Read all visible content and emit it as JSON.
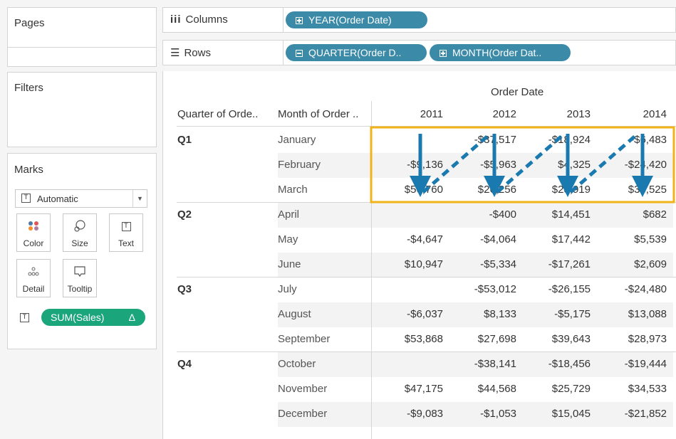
{
  "panels": {
    "pages": "Pages",
    "filters": "Filters",
    "marks": "Marks"
  },
  "marks_card": {
    "type_label": "Automatic",
    "buttons": [
      {
        "label": "Color",
        "icon": "color-dots-icon"
      },
      {
        "label": "Size",
        "icon": "size-icon"
      },
      {
        "label": "Text",
        "icon": "text-icon"
      },
      {
        "label": "Detail",
        "icon": "detail-icon"
      },
      {
        "label": "Tooltip",
        "icon": "tooltip-icon"
      }
    ],
    "field_pill": "SUM(Sales)",
    "field_pill_delta": "Δ"
  },
  "shelves": {
    "columns_label": "Columns",
    "rows_label": "Rows",
    "columns_pills": [
      "YEAR(Order Date)"
    ],
    "rows_pills": [
      "QUARTER(Order D..",
      "MONTH(Order Dat.."
    ]
  },
  "table": {
    "column_group_header": "Order Date",
    "row_headers": [
      "Quarter of Orde..",
      "Month of Order .."
    ],
    "years": [
      "2011",
      "2012",
      "2013",
      "2014"
    ],
    "quarters": [
      "Q1",
      "Q2",
      "Q3",
      "Q4"
    ],
    "rows": [
      {
        "month": "January",
        "values": [
          "",
          "-$37,517",
          "-$18,924",
          "-$6,483"
        ]
      },
      {
        "month": "February",
        "values": [
          "-$9,136",
          "-$5,963",
          "$4,325",
          "-$24,420"
        ]
      },
      {
        "month": "March",
        "values": [
          "$50,760",
          "$26,256",
          "$28,919",
          "$33,525"
        ]
      },
      {
        "month": "April",
        "values": [
          "",
          "-$400",
          "$14,451",
          "$682"
        ]
      },
      {
        "month": "May",
        "values": [
          "-$4,647",
          "-$4,064",
          "$17,442",
          "$5,539"
        ]
      },
      {
        "month": "June",
        "values": [
          "$10,947",
          "-$5,334",
          "-$17,261",
          "$2,609"
        ]
      },
      {
        "month": "July",
        "values": [
          "",
          "-$53,012",
          "-$26,155",
          "-$24,480"
        ]
      },
      {
        "month": "August",
        "values": [
          "-$6,037",
          "$8,133",
          "-$5,175",
          "$13,088"
        ]
      },
      {
        "month": "September",
        "values": [
          "$53,868",
          "$27,698",
          "$39,643",
          "$28,973"
        ]
      },
      {
        "month": "October",
        "values": [
          "",
          "-$38,141",
          "-$18,456",
          "-$19,444"
        ]
      },
      {
        "month": "November",
        "values": [
          "$47,175",
          "$44,568",
          "$25,729",
          "$34,533"
        ]
      },
      {
        "month": "December",
        "values": [
          "-$9,083",
          "-$1,053",
          "$15,045",
          "-$21,852"
        ]
      }
    ]
  },
  "colors": {
    "pill_blue": "#3a8aa8",
    "pill_green": "#1aa57a",
    "highlight": "#f2b31a",
    "arrow": "#1a7ab0"
  }
}
